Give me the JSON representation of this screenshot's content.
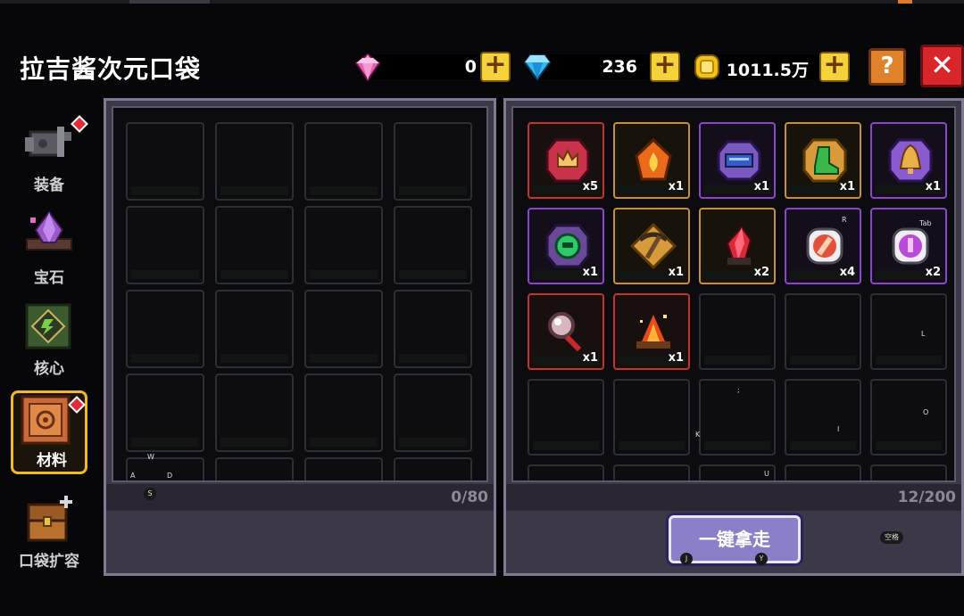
{
  "title": "拉吉酱次元口袋",
  "currency": {
    "pink_gem": "0",
    "blue_gem": "236",
    "gold": "1011.5万"
  },
  "buttons": {
    "plus": "+",
    "help": "?",
    "close": "✕",
    "take_all": "一键拿走"
  },
  "sidebar": [
    {
      "label": "装备",
      "icon": "equipment-icon",
      "badge": true,
      "active": false
    },
    {
      "label": "宝石",
      "icon": "gem-icon",
      "badge": false,
      "active": false
    },
    {
      "label": "核心",
      "icon": "core-icon",
      "badge": false,
      "active": false
    },
    {
      "label": "材料",
      "icon": "material-icon",
      "badge": true,
      "active": true
    },
    {
      "label": "口袋扩容",
      "icon": "chest-icon",
      "badge": false,
      "active": false
    }
  ],
  "left_panel": {
    "count": "0/80"
  },
  "right_panel": {
    "count": "12/200",
    "items": [
      {
        "name": "crown-badge-item",
        "qty": "x5",
        "rarity": "red"
      },
      {
        "name": "fire-crystal-item",
        "qty": "x1",
        "rarity": "orange"
      },
      {
        "name": "blueprint-scroll-item",
        "qty": "x1",
        "rarity": "purple"
      },
      {
        "name": "green-boot-item",
        "qty": "x1",
        "rarity": "orange"
      },
      {
        "name": "bell-item",
        "qty": "x1",
        "rarity": "purple"
      },
      {
        "name": "green-orb-item",
        "qty": "x1",
        "rarity": "purple"
      },
      {
        "name": "pickaxe-item",
        "qty": "x1",
        "rarity": "orange"
      },
      {
        "name": "red-crystal-item",
        "qty": "x2",
        "rarity": "orange"
      },
      {
        "name": "red-potion-item",
        "qty": "x4",
        "rarity": "purple"
      },
      {
        "name": "purple-potion-item",
        "qty": "x2",
        "rarity": "purple"
      },
      {
        "name": "magnifier-item",
        "qty": "x1",
        "rarity": "red"
      },
      {
        "name": "campfire-item",
        "qty": "x1",
        "rarity": "red"
      }
    ]
  },
  "key_hints": [
    "W",
    "A",
    "D",
    "S",
    "R",
    "Tab",
    "L",
    ";",
    "K",
    "I",
    "O",
    "U",
    "J",
    "Y",
    "空格"
  ],
  "colors": {
    "gold_button": "#f4d23c",
    "close_red": "#d9262a",
    "help_orange": "#e0812c",
    "take_button": "#8a7fc8",
    "rarity_red": "#c2342c",
    "rarity_orange": "#c68f30",
    "rarity_purple": "#8a45c8"
  }
}
